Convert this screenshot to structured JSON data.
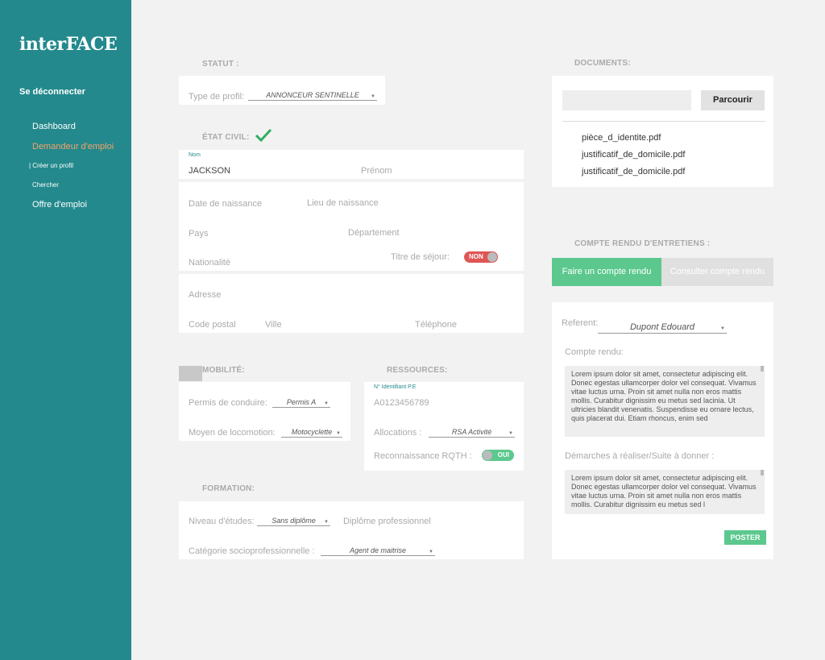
{
  "sidebar": {
    "logo": "interFACE",
    "logout": "Se déconnecter",
    "nav": {
      "dashboard": "Dashboard",
      "demandeur": "Demandeur d'emploi",
      "creer": "| Créer un profil",
      "chercher": "Chercher",
      "offre": "Offre d'emploi"
    }
  },
  "statut": {
    "title": "STATUT :",
    "type_label": "Type de profil:",
    "type_value": "ANNONCEUR SENTINELLE"
  },
  "etat_civil": {
    "title": "ÉTAT CIVIL:",
    "nom_label": "Nom",
    "nom_value": "JACKSON",
    "prenom": "Prénom",
    "date_naissance": "Date de naissance",
    "lieu_naissance": "Lieu de naissance",
    "pays": "Pays",
    "departement": "Département",
    "nationalite": "Nationalité",
    "titre_sejour": "Titre de séjour:",
    "titre_sejour_toggle": "NON",
    "adresse": "Adresse",
    "code_postal": "Code postal",
    "ville": "Ville",
    "telephone": "Téléphone"
  },
  "mobilite": {
    "title": "MOBILITÉ:",
    "permis_label": "Permis de conduire:",
    "permis_value": "Permis A",
    "locomotion_label": "Moyen de locomotion:",
    "locomotion_value": "Motocyclette"
  },
  "ressources": {
    "title": "RESSOURCES:",
    "identifiant_label": "N° Identifiant P.E",
    "identifiant_value": "A0123456789",
    "allocations_label": "Allocations :",
    "allocations_value": "RSA Activité",
    "rqth_label": "Reconnaissance RQTH :",
    "rqth_toggle": "OUI"
  },
  "formation": {
    "title": "FORMATION:",
    "niveau_label": "Niveau d'études:",
    "niveau_value": "Sans diplôme",
    "diplome": "Diplôme professionnel",
    "categorie_label": "Catégorie socioprofessionnelle :",
    "categorie_value": "Agent de maitrise"
  },
  "documents": {
    "title": "DOCUMENTS:",
    "browse": "Parcourir",
    "files": [
      "pièce_d_identite.pdf",
      "justificatif_de_domicile.pdf",
      "justificatif_de_domicile.pdf"
    ]
  },
  "compte_rendu": {
    "title": "COMPTE RENDU D'ENTRETIENS :",
    "tab_active": "Faire un compte rendu",
    "tab_other": "Consulter compte rendu",
    "referent_label": "Referent:",
    "referent_value": "Dupont Edouard",
    "cr_label": "Compte rendu:",
    "cr_text": "Lorem ipsum dolor sit amet, consectetur adipiscing elit. Donec egestas ullamcorper dolor vel consequat. Vivamus vitae luctus urna. Proin sit amet nulla non eros mattis mollis. Curabitur dignissim eu metus sed lacinia. Ut ultricies blandit venenatis. Suspendisse eu ornare lectus, quis placerat dui. Etiam rhoncus, enim sed",
    "demarches_label": "Démarches à réaliser/Suite à donner :",
    "demarches_text": "Lorem ipsum dolor sit amet, consectetur adipiscing elit. Donec egestas ullamcorper dolor vel consequat. Vivamus vitae luctus urna. Proin sit amet nulla non eros mattis mollis. Curabitur dignissim eu metus sed l",
    "post": "POSTER"
  },
  "colors": {
    "sidebar": "#23898c",
    "accent_green": "#5cc88e",
    "accent_orange": "#f4a26b",
    "toggle_red": "#e05555"
  },
  "icons": {
    "checkmark": "check-icon",
    "caret": "caret-down-icon"
  }
}
